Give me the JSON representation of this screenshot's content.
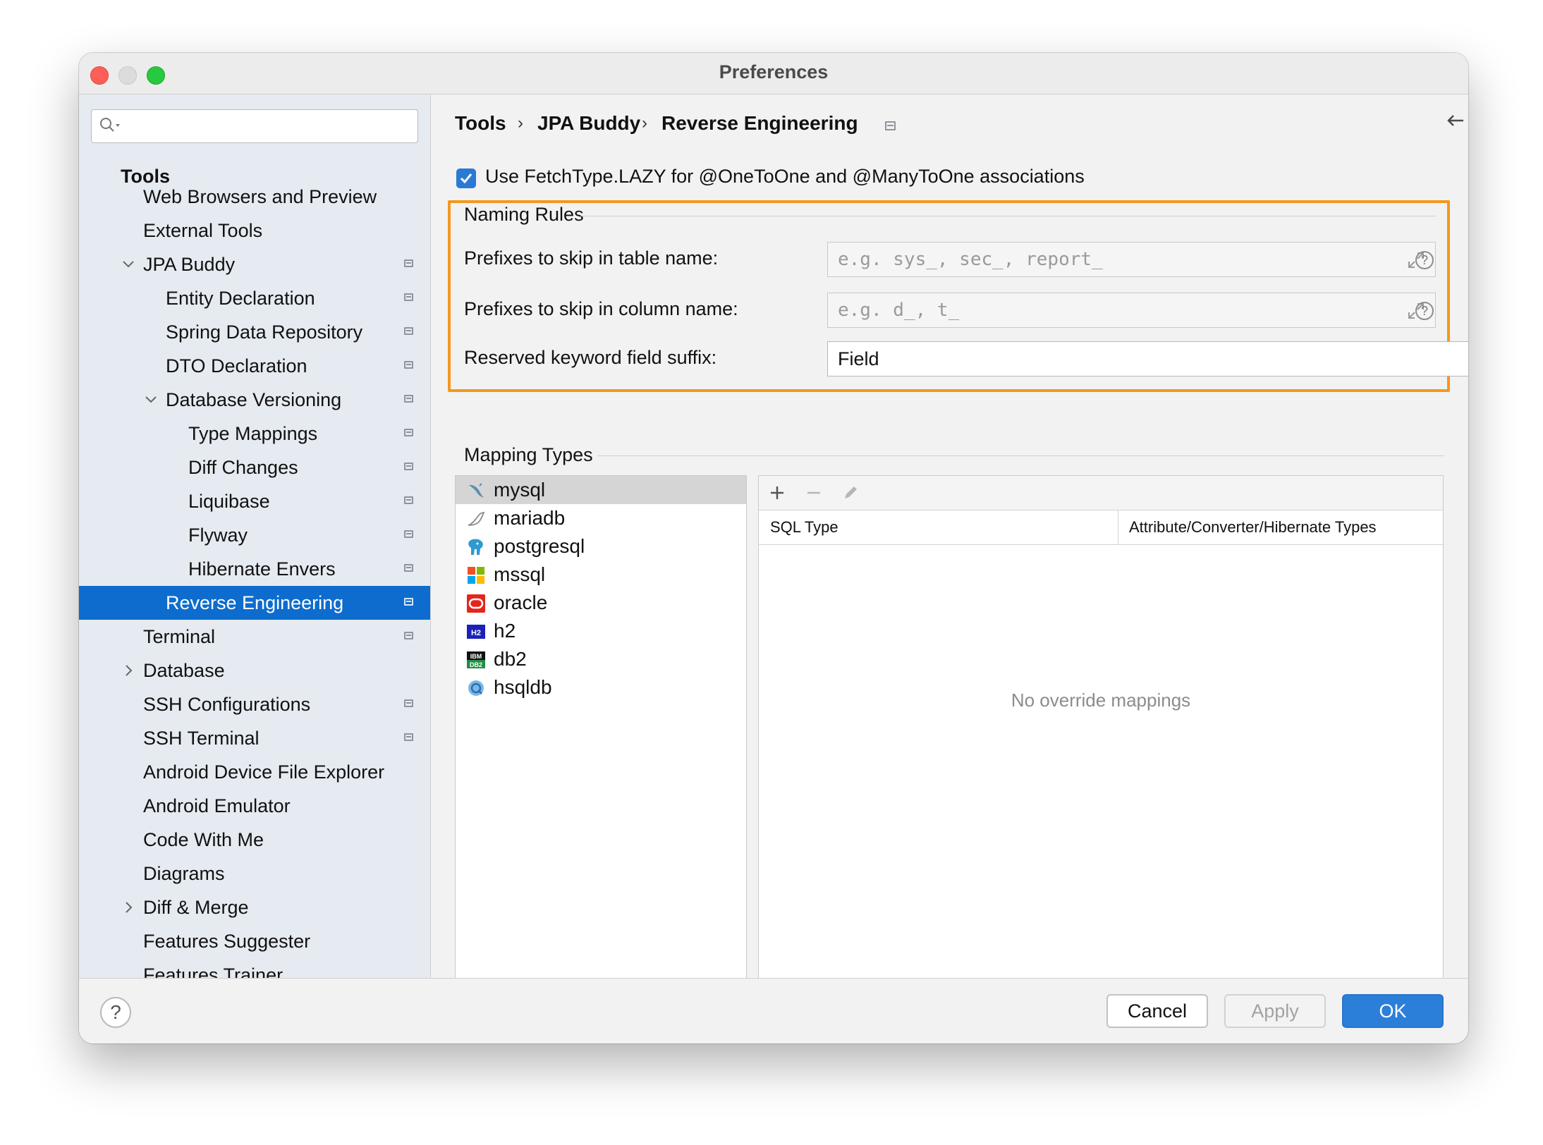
{
  "window": {
    "title": "Preferences"
  },
  "sidebar": {
    "search_placeholder": "",
    "items": [
      {
        "label": "Tools",
        "heading": true
      },
      {
        "label": "Web Browsers and Preview"
      },
      {
        "label": "External Tools"
      },
      {
        "label": "JPA Buddy",
        "expanded": true,
        "project_icon": true
      },
      {
        "label": "Entity Declaration",
        "project_icon": true
      },
      {
        "label": "Spring Data Repository",
        "project_icon": true
      },
      {
        "label": "DTO Declaration",
        "project_icon": true
      },
      {
        "label": "Database Versioning",
        "expanded": true,
        "project_icon": true
      },
      {
        "label": "Type Mappings",
        "project_icon": true
      },
      {
        "label": "Diff Changes",
        "project_icon": true
      },
      {
        "label": "Liquibase",
        "project_icon": true
      },
      {
        "label": "Flyway",
        "project_icon": true
      },
      {
        "label": "Hibernate Envers",
        "project_icon": true
      },
      {
        "label": "Reverse Engineering",
        "selected": true,
        "project_icon": true
      },
      {
        "label": "Terminal",
        "project_icon": true
      },
      {
        "label": "Database",
        "collapsed": true
      },
      {
        "label": "SSH Configurations",
        "project_icon": true
      },
      {
        "label": "SSH Terminal",
        "project_icon": true
      },
      {
        "label": "Android Device File Explorer"
      },
      {
        "label": "Android Emulator"
      },
      {
        "label": "Code With Me"
      },
      {
        "label": "Diagrams"
      },
      {
        "label": "Diff & Merge",
        "collapsed": true
      },
      {
        "label": "Features Suggester"
      },
      {
        "label": "Features Trainer"
      }
    ]
  },
  "breadcrumb": [
    "Tools",
    "JPA Buddy",
    "Reverse Engineering"
  ],
  "breadcrumb_separator": "›",
  "lazy_option": {
    "label": "Use FetchType.LAZY for @OneToOne and @ManyToOne associations",
    "checked": true
  },
  "naming_rules": {
    "title": "Naming Rules",
    "table_prefix": {
      "label": "Prefixes to skip in table name:",
      "placeholder": "e.g. sys_, sec_, report_"
    },
    "column_prefix": {
      "label": "Prefixes to skip in column name:",
      "placeholder": "e.g. d_, t_"
    },
    "keyword_suffix": {
      "label": "Reserved keyword field suffix:",
      "value": "Field"
    },
    "help_glyph": "?"
  },
  "mapping_types": {
    "title": "Mapping Types",
    "databases": [
      {
        "name": "mysql",
        "icon": "mysql-dolphin-icon",
        "selected": true
      },
      {
        "name": "mariadb",
        "icon": "mariadb-seal-icon"
      },
      {
        "name": "postgresql",
        "icon": "postgresql-elephant-icon"
      },
      {
        "name": "mssql",
        "icon": "mssql-windows-icon"
      },
      {
        "name": "oracle",
        "icon": "oracle-icon"
      },
      {
        "name": "h2",
        "icon": "h2-icon"
      },
      {
        "name": "db2",
        "icon": "ibm-db2-icon"
      },
      {
        "name": "hsqldb",
        "icon": "hsqldb-icon"
      }
    ],
    "toolbar": {
      "add": "+",
      "remove": "−"
    },
    "columns": [
      "SQL Type",
      "Attribute/Converter/Hibernate Types"
    ],
    "empty_text": "No override mappings"
  },
  "footer": {
    "help": "?",
    "cancel": "Cancel",
    "apply": "Apply",
    "ok": "OK"
  },
  "colors": {
    "accent": "#0d6cce",
    "highlight": "#f4971f",
    "ok_button": "#2c7fd8"
  }
}
